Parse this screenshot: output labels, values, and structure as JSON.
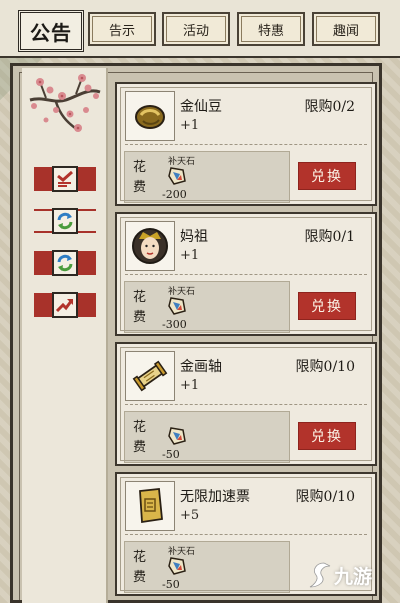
{
  "header": {
    "title": "公告",
    "tabs": [
      {
        "label": "告示"
      },
      {
        "label": "活动"
      },
      {
        "label": "特惠"
      },
      {
        "label": "趣闻"
      }
    ]
  },
  "sidebar": {
    "icons": [
      {
        "name": "checklist-icon"
      },
      {
        "name": "refresh-icon"
      },
      {
        "name": "refresh-icon"
      },
      {
        "name": "trend-up-icon"
      }
    ]
  },
  "shop": {
    "cost_label": "花费",
    "items": [
      {
        "name": "金仙豆",
        "qty": "+1",
        "limit": "限购0/2",
        "resource": "补天石",
        "cost": "-200",
        "button": "兑换",
        "icon": "bean-icon"
      },
      {
        "name": "妈祖",
        "qty": "+1",
        "limit": "限购0/1",
        "resource": "补天石",
        "cost": "-300",
        "button": "兑换",
        "icon": "portrait-icon"
      },
      {
        "name": "金画轴",
        "qty": "+1",
        "limit": "限购0/10",
        "resource": "",
        "cost": "-50",
        "button": "兑换",
        "icon": "scroll-icon"
      },
      {
        "name": "无限加速票",
        "qty": "+5",
        "limit": "限购0/10",
        "resource": "补天石",
        "cost": "-50",
        "button": "",
        "icon": "ticket-icon"
      }
    ]
  },
  "watermark": {
    "text": "九游"
  },
  "colors": {
    "accent": "#b2332b",
    "panel": "#efeadf",
    "border": "#3d372e"
  }
}
